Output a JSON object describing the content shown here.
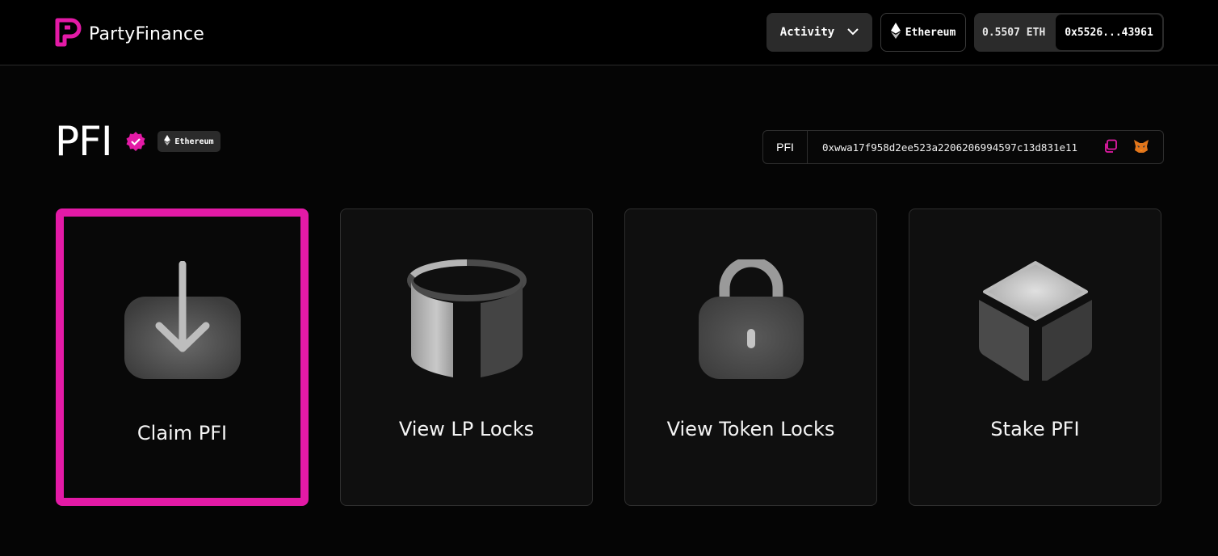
{
  "header": {
    "brand": "PartyFinance",
    "activity_label": "Activity",
    "network_label": "Ethereum",
    "wallet_balance": "0.5507 ETH",
    "wallet_address": "0x5526...43961"
  },
  "token": {
    "symbol": "PFI",
    "chain": "Ethereum",
    "contract_label": "PFI",
    "contract_address": "0xwwa17f958d2ee523a2206206994597c13d831e11"
  },
  "cards": [
    {
      "label": "Claim PFI",
      "icon": "download-tray-icon",
      "active": true
    },
    {
      "label": "View LP Locks",
      "icon": "lp-cylinder-icon",
      "active": false
    },
    {
      "label": "View Token Locks",
      "icon": "padlock-icon",
      "active": false
    },
    {
      "label": "Stake PFI",
      "icon": "cube-icon",
      "active": false
    }
  ],
  "colors": {
    "accent": "#e31aa6",
    "background": "#050505",
    "card": "#0f0f0f",
    "button": "#2b2b2b"
  }
}
